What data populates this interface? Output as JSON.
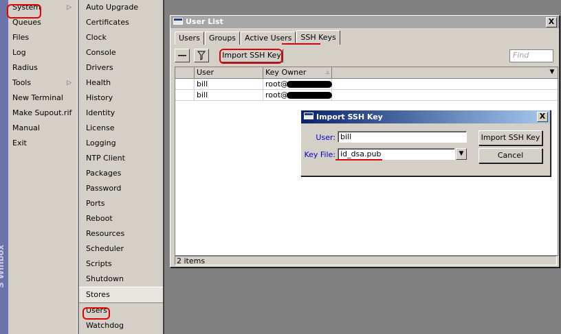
{
  "sidebar": {
    "brand": "S Winbox"
  },
  "main_menu": [
    {
      "label": "System",
      "arrow": "▷"
    },
    {
      "label": "Queues"
    },
    {
      "label": "Files"
    },
    {
      "label": "Log"
    },
    {
      "label": "Radius"
    },
    {
      "label": "Tools",
      "arrow": "▷"
    },
    {
      "label": "New Terminal"
    },
    {
      "label": "Make Supout.rif"
    },
    {
      "label": "Manual"
    },
    {
      "label": "Exit"
    }
  ],
  "sub_menu": [
    "Auto Upgrade",
    "Certificates",
    "Clock",
    "Console",
    "Drivers",
    "Health",
    "History",
    "Identity",
    "License",
    "Logging",
    "NTP Client",
    "Packages",
    "Password",
    "Ports",
    "Reboot",
    "Resources",
    "Scheduler",
    "Scripts",
    "Shutdown",
    "Stores",
    "Users",
    "Watchdog"
  ],
  "window": {
    "title": "User List",
    "close": "X",
    "tabs": [
      "Users",
      "Groups",
      "Active Users",
      "SSH Keys"
    ],
    "toolbar": {
      "remove_icon": "minus-icon",
      "filter_icon": "filter-icon",
      "import_label": "Import SSH Key",
      "find_placeholder": "Find"
    },
    "columns": [
      "User",
      "Key Owner"
    ],
    "sort_indicator": "▵",
    "dropdown": "▼",
    "rows": [
      {
        "user": "bill",
        "key_owner": "root@"
      },
      {
        "user": "bill",
        "key_owner": "root@"
      }
    ],
    "status": "2 items"
  },
  "dialog": {
    "title": "Import SSH Key",
    "close": "X",
    "user_label": "User:",
    "user_value": "bill",
    "keyfile_label": "Key File:",
    "keyfile_value": "id_dsa.pub",
    "keyfile_dropdown": "▼",
    "import_button": "Import SSH Key",
    "cancel_button": "Cancel"
  },
  "colors": {
    "accent_red": "#e00000",
    "dialog_title": "#0a246a",
    "window_bg": "#d4d0c8"
  }
}
